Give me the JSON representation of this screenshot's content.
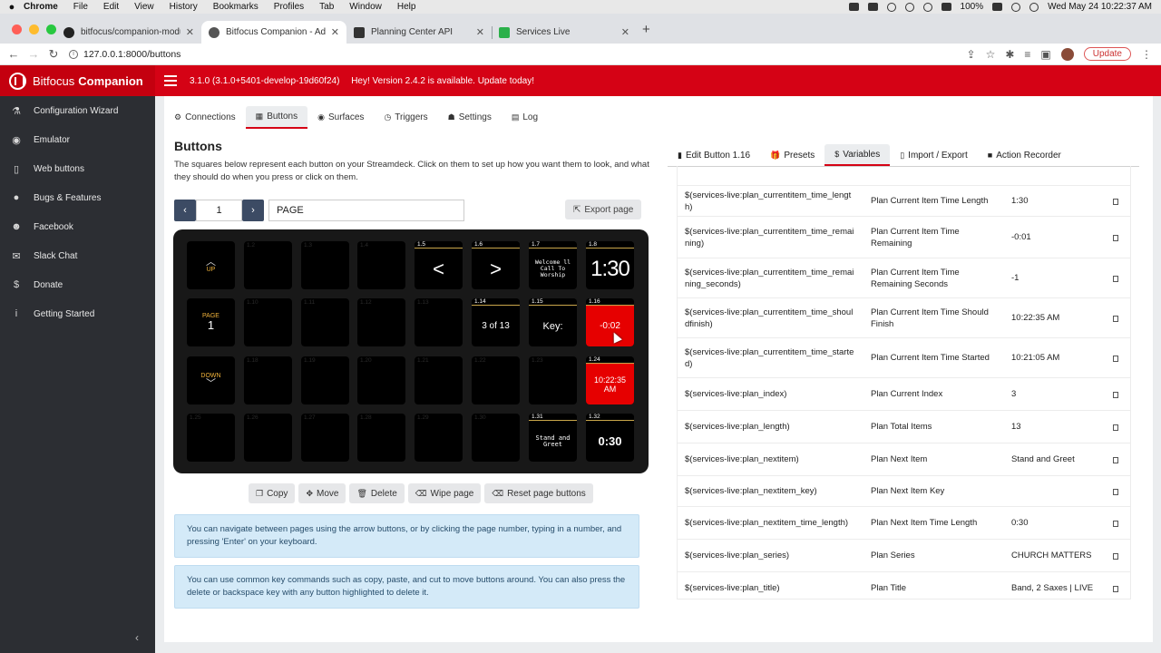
{
  "menubar": {
    "app": "Chrome",
    "items": [
      "File",
      "Edit",
      "View",
      "History",
      "Bookmarks",
      "Profiles",
      "Tab",
      "Window",
      "Help"
    ],
    "battery": "100%",
    "clock": "Wed May 24  10:22:37 AM"
  },
  "tabs": [
    {
      "title": "bitfocus/companion-module-p",
      "color": "#222222"
    },
    {
      "title": "Bitfocus Companion - Admin",
      "color": "#555555"
    },
    {
      "title": "Planning Center API",
      "color": "#333333"
    },
    {
      "title": "Services Live",
      "color": "#2bb04a"
    }
  ],
  "toolbar": {
    "url": "127.0.0.1:8000/buttons",
    "update_label": "Update"
  },
  "header": {
    "brand_light": "Bitfocus",
    "brand_bold": "Companion",
    "version": "3.1.0 (3.1.0+5401-develop-19d60f24)",
    "update_msg": "Hey! Version 2.4.2 is available. Update today!"
  },
  "sidebar": {
    "items": [
      {
        "label": "Configuration Wizard",
        "icon": "wand-icon",
        "glyph": "⚗"
      },
      {
        "label": "Emulator",
        "icon": "gamepad-icon",
        "glyph": "◉"
      },
      {
        "label": "Web buttons",
        "icon": "tablet-icon",
        "glyph": "▯"
      },
      {
        "label": "Bugs & Features",
        "icon": "github-icon",
        "glyph": "●"
      },
      {
        "label": "Facebook",
        "icon": "users-icon",
        "glyph": "☻"
      },
      {
        "label": "Slack Chat",
        "icon": "comments-icon",
        "glyph": "✉"
      },
      {
        "label": "Donate",
        "icon": "dollar-icon",
        "glyph": "$"
      },
      {
        "label": "Getting Started",
        "icon": "info-icon",
        "glyph": "i"
      }
    ]
  },
  "navtabs": [
    {
      "label": "Connections",
      "glyph": "⚙"
    },
    {
      "label": "Buttons",
      "glyph": "▦"
    },
    {
      "label": "Surfaces",
      "glyph": "◉"
    },
    {
      "label": "Triggers",
      "glyph": "◷"
    },
    {
      "label": "Settings",
      "glyph": "☗"
    },
    {
      "label": "Log",
      "glyph": "▤"
    }
  ],
  "buttons": {
    "title": "Buttons",
    "description": "The squares below represent each button on your Streamdeck. Click on them to set up how you want them to look, and what they should do when you press or click on them.",
    "page_number": "1",
    "page_name": "PAGE",
    "export_label": "Export page",
    "nav_up": "UP",
    "nav_page": "PAGE",
    "nav_down": "DOWN",
    "keys": {
      "k15": {
        "num": "1.5",
        "text": "<"
      },
      "k16": {
        "num": "1.6",
        "text": ">"
      },
      "k17": {
        "num": "1.7",
        "text": "Welcome ll Call To Worship"
      },
      "k18": {
        "num": "1.8",
        "text": "1:30"
      },
      "k114": {
        "num": "1.14",
        "text": "3 of 13"
      },
      "k115": {
        "num": "1.15",
        "text": "Key:"
      },
      "k116": {
        "num": "1.16",
        "text": "-0:02"
      },
      "k124": {
        "num": "1.24",
        "text": "10:22:35 AM"
      },
      "k131": {
        "num": "1.31",
        "text": "Stand and Greet"
      },
      "k132": {
        "num": "1.32",
        "text": "0:30"
      }
    },
    "empty_nums": [
      "1.2",
      "1.3",
      "1.4",
      "1.10",
      "1.11",
      "1.12",
      "1.13",
      "1.18",
      "1.19",
      "1.20",
      "1.21",
      "1.22",
      "1.23",
      "1.25",
      "1.26",
      "1.27",
      "1.28",
      "1.29",
      "1.30"
    ],
    "actions": [
      {
        "label": "Copy",
        "glyph": "❐"
      },
      {
        "label": "Move",
        "glyph": "✥"
      },
      {
        "label": "Delete",
        "glyph": "🗑"
      },
      {
        "label": "Wipe page",
        "glyph": "⌫"
      },
      {
        "label": "Reset page buttons",
        "glyph": "⌫"
      }
    ],
    "info1": "You can navigate between pages using the arrow buttons, or by clicking the page number, typing in a number, and pressing 'Enter' on your keyboard.",
    "info2": "You can use common key commands such as copy, paste, and cut to move buttons around. You can also press the delete or backspace key with any button highlighted to delete it."
  },
  "right_tabs": [
    {
      "label": "Edit Button 1.16",
      "glyph": "▮"
    },
    {
      "label": "Presets",
      "glyph": "🎁"
    },
    {
      "label": "Variables",
      "glyph": "$"
    },
    {
      "label": "Import / Export",
      "glyph": "▯"
    },
    {
      "label": "Action Recorder",
      "glyph": "■"
    }
  ],
  "variables": [
    {
      "name": "$(services-live:plan_currentitem_time_length)",
      "desc": "Plan Current Item Time Length",
      "value": "1:30"
    },
    {
      "name": "$(services-live:plan_currentitem_time_remaining)",
      "desc": "Plan Current Item Time Remaining",
      "value": "-0:01"
    },
    {
      "name": "$(services-live:plan_currentitem_time_remaining_seconds)",
      "desc": "Plan Current Item Time Remaining Seconds",
      "value": "-1"
    },
    {
      "name": "$(services-live:plan_currentitem_time_shouldfinish)",
      "desc": "Plan Current Item Time Should Finish",
      "value": "10:22:35 AM"
    },
    {
      "name": "$(services-live:plan_currentitem_time_started)",
      "desc": "Plan Current Item Time Started",
      "value": "10:21:05 AM"
    },
    {
      "name": "$(services-live:plan_index)",
      "desc": "Plan Current Index",
      "value": "3"
    },
    {
      "name": "$(services-live:plan_length)",
      "desc": "Plan Total Items",
      "value": "13"
    },
    {
      "name": "$(services-live:plan_nextitem)",
      "desc": "Plan Next Item",
      "value": "Stand and Greet"
    },
    {
      "name": "$(services-live:plan_nextitem_key)",
      "desc": "Plan Next Item Key",
      "value": ""
    },
    {
      "name": "$(services-live:plan_nextitem_time_length)",
      "desc": "Plan Next Item Time Length",
      "value": "0:30"
    },
    {
      "name": "$(services-live:plan_series)",
      "desc": "Plan Series",
      "value": "CHURCH MATTERS"
    },
    {
      "name": "$(services-live:plan_title)",
      "desc": "Plan Title",
      "value": "Band, 2 Saxes | LIVE"
    }
  ]
}
